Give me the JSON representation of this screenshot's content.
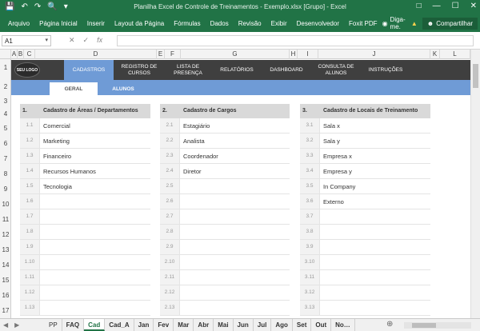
{
  "titlebar": {
    "title": "Planilha Excel de Controle de Treinamentos - Exemplo.xlsx  [Grupo] - Excel",
    "save_icon": "save-icon",
    "undo_icon": "undo-icon",
    "redo_icon": "redo-icon",
    "preview_icon": "print-preview-icon"
  },
  "ribbon": {
    "tabs": [
      "Arquivo",
      "Página Inicial",
      "Inserir",
      "Layout da Página",
      "Fórmulas",
      "Dados",
      "Revisão",
      "Exibir",
      "Desenvolvedor",
      "Foxit PDF"
    ],
    "tell_me": "Diga-me.",
    "share": "Compartilhar"
  },
  "formula_bar": {
    "name_box": "A1",
    "cancel": "✕",
    "enter": "✓",
    "fx": "fx",
    "value": ""
  },
  "columns": [
    "A",
    "B",
    "C",
    "D",
    "E",
    "F",
    "G",
    "H",
    "I",
    "J",
    "K",
    "L"
  ],
  "rows": [
    "1",
    "2",
    "3",
    "4",
    "5",
    "6",
    "7",
    "8",
    "9",
    "10",
    "11",
    "12",
    "13",
    "14",
    "15",
    "16",
    "17"
  ],
  "nav": {
    "logo": "SEU LOGO",
    "items": [
      "CADASTROS",
      "REGISTRO DE CURSOS",
      "LISTA DE PRESENÇA",
      "RELATÓRIOS",
      "DASHBOARD",
      "CONSULTA DE ALUNOS",
      "INSTRUÇÕES"
    ],
    "active": "CADASTROS",
    "sub_items": [
      "GERAL",
      "ALUNOS"
    ],
    "sub_active": "GERAL"
  },
  "tables": [
    {
      "num": "1.",
      "title": "Cadastro de Áreas / Departamentos",
      "rows": [
        {
          "idx": "1.1",
          "val": "Comercial"
        },
        {
          "idx": "1.2",
          "val": "Marketing"
        },
        {
          "idx": "1.3",
          "val": "Financeiro"
        },
        {
          "idx": "1.4",
          "val": "Recursos Humanos"
        },
        {
          "idx": "1.5",
          "val": "Tecnologia"
        },
        {
          "idx": "1.6",
          "val": ""
        },
        {
          "idx": "1.7",
          "val": ""
        },
        {
          "idx": "1.8",
          "val": ""
        },
        {
          "idx": "1.9",
          "val": ""
        },
        {
          "idx": "1.10",
          "val": ""
        },
        {
          "idx": "1.11",
          "val": ""
        },
        {
          "idx": "1.12",
          "val": ""
        },
        {
          "idx": "1.13",
          "val": ""
        }
      ]
    },
    {
      "num": "2.",
      "title": "Cadastro de Cargos",
      "rows": [
        {
          "idx": "2.1",
          "val": "Estagiário"
        },
        {
          "idx": "2.2",
          "val": "Analista"
        },
        {
          "idx": "2.3",
          "val": "Coordenador"
        },
        {
          "idx": "2.4",
          "val": "Diretor"
        },
        {
          "idx": "2.5",
          "val": ""
        },
        {
          "idx": "2.6",
          "val": ""
        },
        {
          "idx": "2.7",
          "val": ""
        },
        {
          "idx": "2.8",
          "val": ""
        },
        {
          "idx": "2.9",
          "val": ""
        },
        {
          "idx": "2.10",
          "val": ""
        },
        {
          "idx": "2.11",
          "val": ""
        },
        {
          "idx": "2.12",
          "val": ""
        },
        {
          "idx": "2.13",
          "val": ""
        }
      ]
    },
    {
      "num": "3.",
      "title": "Cadastro de Locais de Treinamento",
      "rows": [
        {
          "idx": "3.1",
          "val": "Sala x"
        },
        {
          "idx": "3.2",
          "val": "Sala y"
        },
        {
          "idx": "3.3",
          "val": "Empresa x"
        },
        {
          "idx": "3.4",
          "val": "Empresa y"
        },
        {
          "idx": "3.5",
          "val": "In Company"
        },
        {
          "idx": "3.6",
          "val": "Externo"
        },
        {
          "idx": "3.7",
          "val": ""
        },
        {
          "idx": "3.8",
          "val": ""
        },
        {
          "idx": "3.9",
          "val": ""
        },
        {
          "idx": "3.10",
          "val": ""
        },
        {
          "idx": "3.11",
          "val": ""
        },
        {
          "idx": "3.12",
          "val": ""
        },
        {
          "idx": "3.13",
          "val": ""
        }
      ]
    }
  ],
  "sheets": {
    "tabs": [
      "PP",
      "FAQ",
      "Cad",
      "Cad_A",
      "Jan",
      "Fev",
      "Mar",
      "Abr",
      "Mai",
      "Jun",
      "Jul",
      "Ago",
      "Set",
      "Out",
      "No…"
    ],
    "active": "Cad"
  },
  "colors": {
    "excel_green": "#217346",
    "nav_dark": "#3f3f3f",
    "nav_blue": "#6f9bd6",
    "header_gray": "#d9d9d9"
  }
}
